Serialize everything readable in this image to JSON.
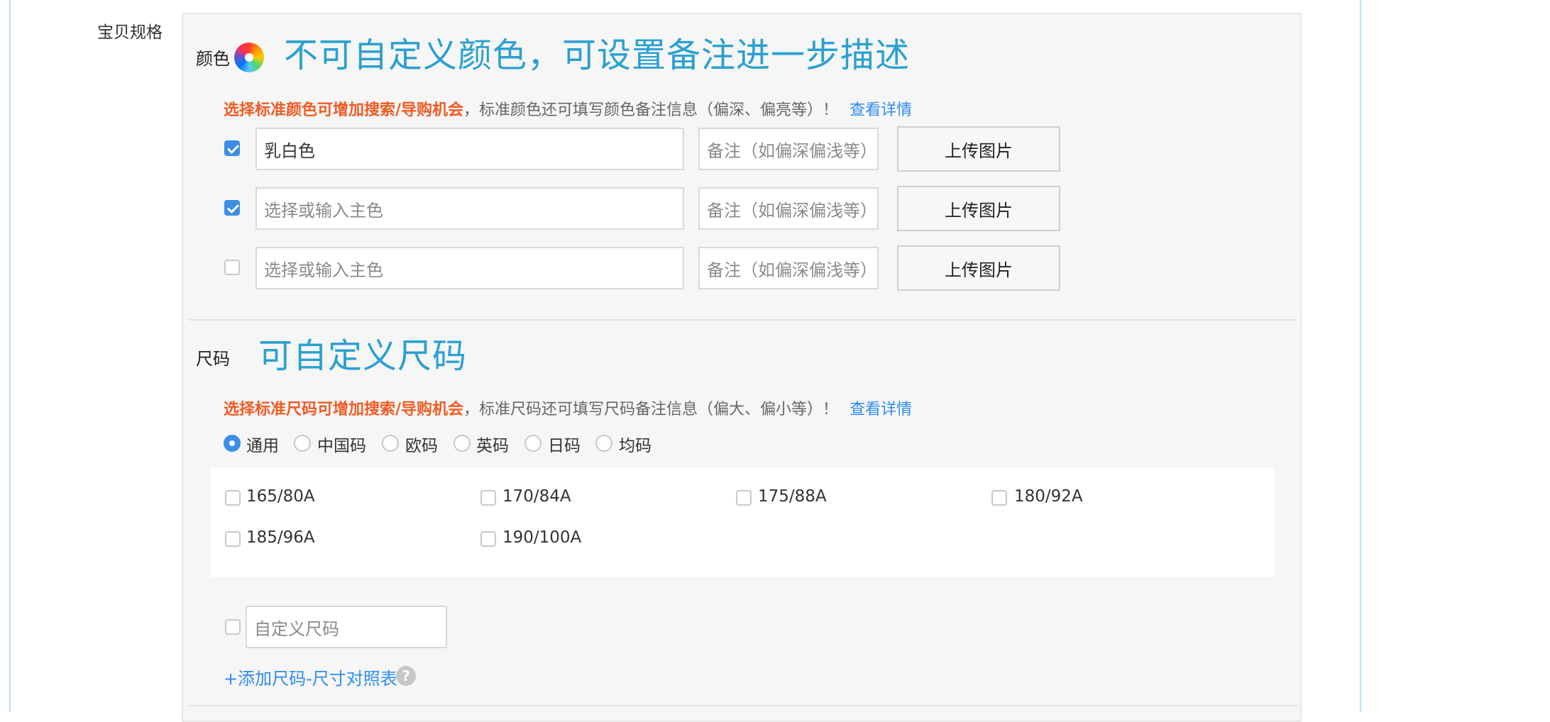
{
  "field": {
    "label": "宝贝规格"
  },
  "color_section": {
    "label": "颜色",
    "annotation": "不可自定义颜色，可设置备注进一步描述",
    "hint": {
      "highlight": "选择标准颜色可增加搜索/导购机会",
      "text": "，标准颜色还可填写颜色备注信息（偏深、偏亮等）！",
      "link": "查看详情"
    },
    "rows": [
      {
        "checked": true,
        "value": "乳白色",
        "placeholder": "选择或输入主色",
        "note_placeholder": "备注（如偏深偏浅等）",
        "upload_label": "上传图片"
      },
      {
        "checked": true,
        "value": "",
        "placeholder": "选择或输入主色",
        "note_placeholder": "备注（如偏深偏浅等）",
        "upload_label": "上传图片"
      },
      {
        "checked": false,
        "value": "",
        "placeholder": "选择或输入主色",
        "note_placeholder": "备注（如偏深偏浅等）",
        "upload_label": "上传图片"
      }
    ]
  },
  "size_section": {
    "label": "尺码",
    "annotation": "可自定义尺码",
    "hint": {
      "highlight": "选择标准尺码可增加搜索/导购机会",
      "text": "，标准尺码还可填写尺码备注信息（偏大、偏小等）！",
      "link": "查看详情"
    },
    "size_systems": [
      "通用",
      "中国码",
      "欧码",
      "英码",
      "日码",
      "均码"
    ],
    "selected_system": "通用",
    "sizes": [
      "165/80A",
      "170/84A",
      "175/88A",
      "180/92A",
      "185/96A",
      "190/100A"
    ],
    "custom": {
      "placeholder": "自定义尺码"
    },
    "add_link": "+添加尺码-尺寸对照表",
    "help_symbol": "?"
  }
}
